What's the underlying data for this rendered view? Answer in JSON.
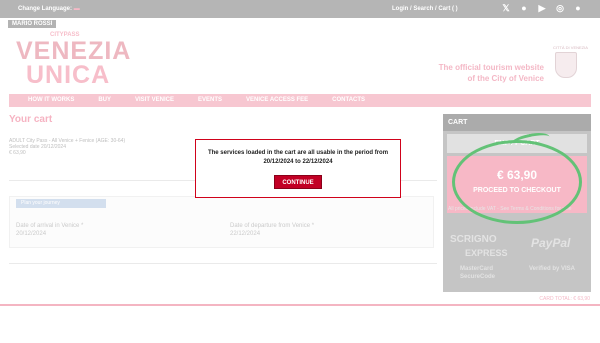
{
  "topbar": {
    "change_language": "Change Language:",
    "links": "Login  /  Search  /  Cart ( )",
    "socials": [
      "x-icon",
      "facebook-icon",
      "youtube-icon",
      "instagram-icon",
      "pinterest-icon"
    ]
  },
  "user": {
    "name": "MARIO ROSSI"
  },
  "logo": {
    "citypass": "CITYPASS",
    "line1": "VENEZIA",
    "line2": "UNICA"
  },
  "header": {
    "tagline_line1": "The official tourism website",
    "tagline_line2": "of the City of Venice",
    "crest_label": "CITTÀ DI VENEZIA"
  },
  "nav": {
    "items": [
      "HOW IT WORKS",
      "BUY",
      "VISIT VENICE",
      "EVENTS",
      "VENICE ACCESS FEE",
      "CONTACTS"
    ]
  },
  "cart": {
    "title": "Your cart",
    "item_name": "ADULT City Pass - All Venice + Fenice (AGE: 30-64)",
    "item_date": "Selected date 20/12/2024",
    "item_price": "€ 63,90"
  },
  "journey": {
    "tab_label": "Plan your journey",
    "arrival_label": "Date of arrival in Venice *",
    "arrival_value": "20/12/2024",
    "departure_label": "Date of departure from Venice *",
    "departure_value": "22/12/2024"
  },
  "sidebar": {
    "title": "CART",
    "empty_cart": "EMPTY CART",
    "total_price": "€ 63,90",
    "checkout": "PROCEED TO CHECKOUT",
    "vat_note": "All prices include VAT - See Terms & Conditions for sale",
    "payments": [
      "SCRIGNO",
      "PayPal",
      "EXPRESS",
      "MasterCard SecureCode",
      "Verified by VISA"
    ]
  },
  "card_total": "CARD TOTAL: € 63,90",
  "modal": {
    "message": "The services loaded in the cart are all usable in the period from 20/12/2024 to 22/12/2024",
    "button": "CONTINUE"
  },
  "colors": {
    "accent_pink": "#f4a0b3",
    "modal_red": "#c20025",
    "highlight_green": "#2fae4a"
  }
}
